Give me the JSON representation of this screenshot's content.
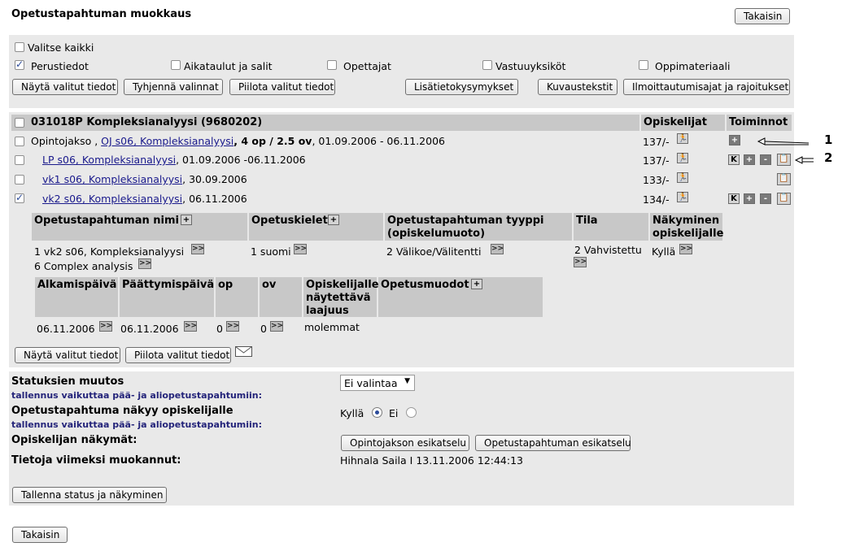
{
  "page_title": "Opetustapahtuman muokkaus",
  "back_label": "Takaisin",
  "selection": {
    "select_all": "Valitse kaikki",
    "options": [
      {
        "label": "Perustiedot",
        "checked": true
      },
      {
        "label": "Aikataulut ja salit",
        "checked": false
      },
      {
        "label": "Opettajat",
        "checked": false
      },
      {
        "label": "Vastuuyksiköt",
        "checked": false
      },
      {
        "label": "Oppimateriaali",
        "checked": false
      }
    ],
    "buttons": {
      "show_selected": "Näytä valitut tiedot",
      "clear": "Tyhjennä valinnat",
      "hide_selected": "Piilota valitut tiedot",
      "extra_questions": "Lisätietokysymykset",
      "descriptions": "Kuvaustekstit",
      "registration": "Ilmoittautumisajat ja rajoitukset"
    }
  },
  "course": {
    "title": "031018P Kompleksianalyysi (9680202)",
    "col_students": "Opiskelijat",
    "col_actions": "Toiminnot",
    "rows": [
      {
        "prefix": "Opintojakso , ",
        "link": "OJ s06, Kompleksianalyysi",
        "bold_part": ", 4 op / 2.5 ov",
        "rest": ", 01.09.2006 - 06.11.2006",
        "students": "137/-",
        "checked": false
      },
      {
        "prefix": "",
        "link": "LP s06, Kompleksianalyysi",
        "bold_part": "",
        "rest": ", 01.09.2006 -06.11.2006",
        "students": "137/-",
        "checked": false
      },
      {
        "prefix": "",
        "link": "vk1 s06, Kompleksianalyysi",
        "bold_part": "",
        "rest": ", 30.09.2006",
        "students": "133/-",
        "checked": false
      },
      {
        "prefix": "",
        "link": "vk2 s06, Kompleksianalyysi",
        "bold_part": "",
        "rest": ", 06.11.2006",
        "students": "134/-",
        "checked": true
      }
    ],
    "annotations": [
      "1",
      "2"
    ],
    "icon_labels": {
      "k": "K",
      "plus": "+",
      "minus": "-",
      "more": ">>"
    }
  },
  "details": {
    "headers1": [
      "Opetustapahtuman nimi",
      "Opetuskielet",
      "Opetustapahtuman tyyppi (opiskelumuoto)",
      "Tila",
      "Näkyminen opiskelijalle"
    ],
    "names": [
      "1 vk2 s06, Kompleksianalyysi",
      "6 Complex analysis"
    ],
    "language": "1 suomi",
    "type": "2 Välikoe/Välitentti",
    "state": "2 Vahvistettu",
    "visible": "Kyllä",
    "headers2": [
      "Alkamispäivä",
      "Päättymispäivä",
      "op",
      "ov",
      "Opiskelijalle näytettävä laajuus",
      "Opetusmuodot"
    ],
    "start": "06.11.2006",
    "end": "06.11.2006",
    "op": "0",
    "ov": "0",
    "scope": "molemmat",
    "buttons": {
      "show_selected": "Näytä valitut tiedot",
      "hide_selected": "Piilota valitut tiedot"
    }
  },
  "status": {
    "status_change_label": "Statuksien muutos",
    "note": "tallennus vaikuttaa pää- ja aliopetustapahtumiin:",
    "status_select": "Ei valintaa",
    "visibility_label": "Opetustapahtuma näkyy opiskelijalle",
    "yes": "Kyllä",
    "no": "Ei",
    "student_views_label": "Opiskelijan näkymät:",
    "preview_course": "Opintojakson esikatselu",
    "preview_event": "Opetustapahtuman esikatselu",
    "last_modified_label": "Tietoja viimeksi muokannut:",
    "last_modified_value": "Hihnala Saila I 13.11.2006 12:44:13",
    "save": "Tallenna status ja näkyminen"
  }
}
